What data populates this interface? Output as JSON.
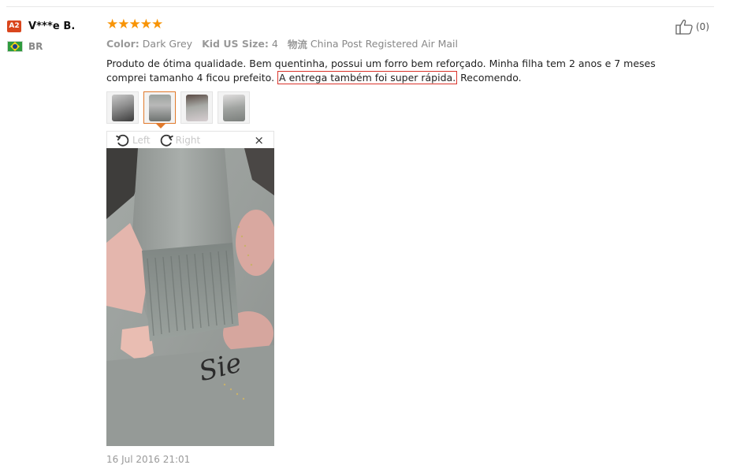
{
  "user": {
    "level_badge": "A2",
    "name": "V***e B.",
    "country_code": "BR"
  },
  "review": {
    "rating": 5,
    "attributes": [
      {
        "key": "Color:",
        "value": "Dark Grey"
      },
      {
        "key": "Kid US Size:",
        "value": "4"
      },
      {
        "key": "物流",
        "value": "China Post Registered Air Mail"
      }
    ],
    "text_before": "Produto de ótima qualidade. Bem quentinha, possui um forro bem reforçado. Minha filha tem 2 anos e 7 meses comprei tamanho 4 ficou prefeito. ",
    "text_highlight": "A entrega também foi super rápida.",
    "text_after": " Recomendo.",
    "date": "16 Jul 2016 21:01"
  },
  "viewer": {
    "rotate_left_label": "Left",
    "rotate_right_label": "Right",
    "close_label": "×",
    "selected_thumbnail": 2
  },
  "helpful": {
    "count_label": "(0)"
  },
  "icons": {
    "star": "star-icon",
    "rotate_left": "rotate-left-icon",
    "rotate_right": "rotate-right-icon",
    "thumbs_up": "thumbs-up-icon",
    "close": "close-icon",
    "flag": "brazil-flag-icon"
  },
  "colors": {
    "star": "#f89406",
    "badge": "#d9461d",
    "highlight_border": "#d9342b",
    "active_thumb": "#e0792b"
  }
}
